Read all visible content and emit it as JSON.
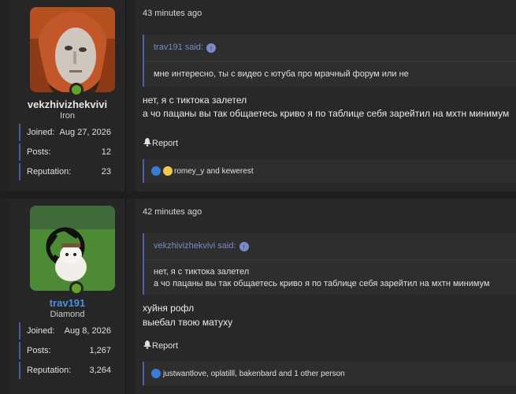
{
  "posts": [
    {
      "author": {
        "name": "vekzhivizhekvivi",
        "title": "Iron",
        "name_color": "#e6e6e6",
        "stats": [
          {
            "label": "Joined:",
            "value": "Aug 27, 2026"
          },
          {
            "label": "Posts:",
            "value": "12"
          },
          {
            "label": "Reputation:",
            "value": "23"
          }
        ]
      },
      "time": "43 minutes ago",
      "quote": {
        "author": "trav191 said:",
        "lines": [
          "мне интересно, ты с видео с ютуба про мрачный форум или не"
        ]
      },
      "message_lines": [
        "нет, я с тиктока залетел",
        "а чо пацаны вы так общаетесь криво я по таблице себя зарейтил на мхтн минимум"
      ],
      "report_label": "Report",
      "reactions": "romey_y and kewerest"
    },
    {
      "author": {
        "name": "trav191",
        "title": "Diamond",
        "name_color": "#4f8fe0",
        "stats": [
          {
            "label": "Joined:",
            "value": "Aug 8, 2026"
          },
          {
            "label": "Posts:",
            "value": "1,267"
          },
          {
            "label": "Reputation:",
            "value": "3,264"
          }
        ]
      },
      "time": "42 minutes ago",
      "quote": {
        "author": "vekzhivizhekvivi said:",
        "lines": [
          "нет, я с тиктока залетел",
          "а чо пацаны вы так общаетесь криво я по таблице себя зарейтил на мхтн минимум"
        ]
      },
      "message_lines": [
        "хуйня рофл",
        "выебал твою матуху"
      ],
      "report_label": "Report",
      "reactions": "justwantlove, oplatilll, bakenbard and 1 other person"
    }
  ]
}
